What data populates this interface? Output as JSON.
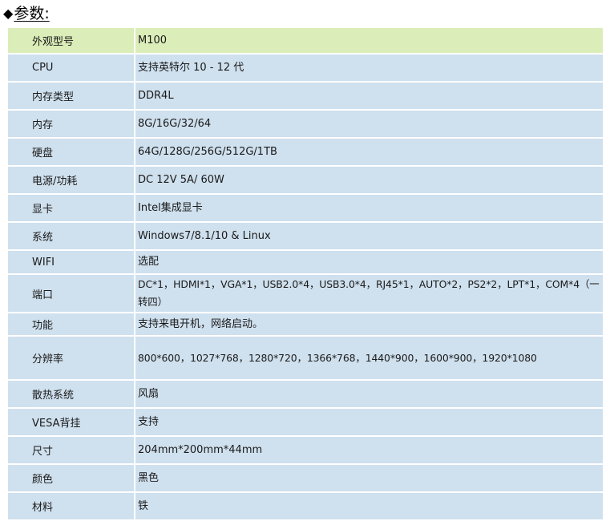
{
  "section": {
    "marker": "◆",
    "title": "参数:"
  },
  "spec_table": {
    "rows": [
      {
        "label": "外观型号",
        "value": "M100"
      },
      {
        "label": "CPU",
        "value": "支持英特尔 10 - 12 代"
      },
      {
        "label": "内存类型",
        "value": "DDR4L"
      },
      {
        "label": "内存",
        "value": "8G/16G/32/64"
      },
      {
        "label": "硬盘",
        "value": "64G/128G/256G/512G/1TB"
      },
      {
        "label": "电源/功耗",
        "value": " DC 12V 5A/ 60W"
      },
      {
        "label": "显卡",
        "value": "Intel集成显卡"
      },
      {
        "label": "系统",
        "value": "Windows7/8.1/10 & Linux"
      },
      {
        "label": "WIFI",
        "value": "选配"
      },
      {
        "label": "端口",
        "value": "DC*1，HDMI*1，VGA*1，USB2.0*4，USB3.0*4，RJ45*1，AUTO*2，PS2*2，LPT*1，COM*4（一转四）"
      },
      {
        "label": "功能",
        "value": "支持来电开机，网络启动。"
      },
      {
        "label": "分辨率",
        "value": "800*600，1027*768，1280*720，1366*768，1440*900，1600*900，1920*1080"
      },
      {
        "label": "散热系统",
        "value": "风扇"
      },
      {
        "label": "VESA背挂",
        "value": "支持"
      },
      {
        "label": "尺寸",
        "value": "204mm*200mm*44mm"
      },
      {
        "label": "颜色",
        "value": "黑色"
      },
      {
        "label": "材料",
        "value": "铁"
      }
    ]
  }
}
